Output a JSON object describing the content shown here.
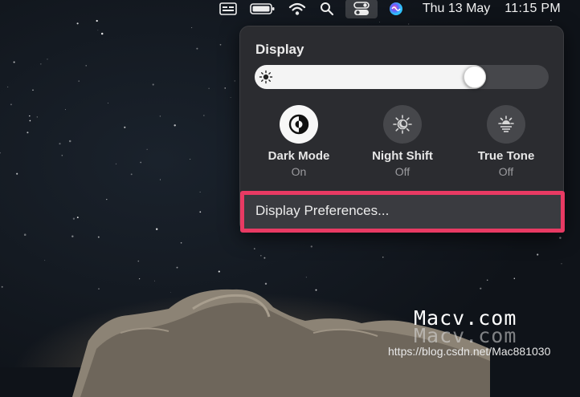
{
  "menubar": {
    "date": "Thu 13 May",
    "time": "11:15 PM",
    "icons": [
      "input-menu-icon",
      "battery-icon",
      "wifi-icon",
      "spotlight-icon",
      "control-center-icon",
      "siri-icon"
    ]
  },
  "panel": {
    "title": "Display",
    "brightness_level": 0.77,
    "toggles": [
      {
        "label": "Dark Mode",
        "state": "On",
        "icon": "dark-mode-icon",
        "on": true
      },
      {
        "label": "Night Shift",
        "state": "Off",
        "icon": "night-shift-icon",
        "on": false
      },
      {
        "label": "True Tone",
        "state": "Off",
        "icon": "true-tone-icon",
        "on": false
      }
    ],
    "preferences_label": "Display Preferences...",
    "highlight_color": "#e83a63"
  },
  "watermark": {
    "brand": "Macv.com",
    "brand_reflection": "Macv.com",
    "url": "https://blog.csdn.net/Mac881030"
  }
}
